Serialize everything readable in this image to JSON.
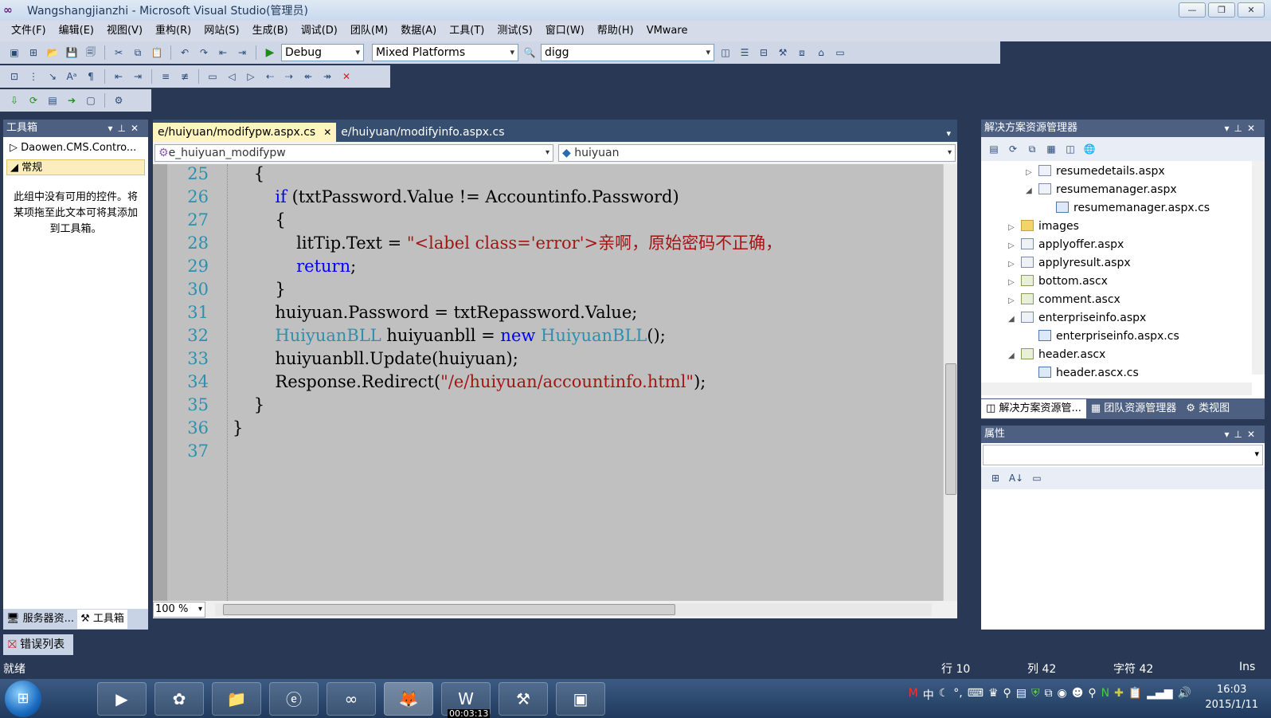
{
  "window": {
    "title": "Wangshangjianzhi - Microsoft Visual Studio(管理员)",
    "minimize": "—",
    "restore": "❐",
    "close": "✕"
  },
  "menu": [
    "文件(F)",
    "编辑(E)",
    "视图(V)",
    "重构(R)",
    "网站(S)",
    "生成(B)",
    "调试(D)",
    "团队(M)",
    "数据(A)",
    "工具(T)",
    "测试(S)",
    "窗口(W)",
    "帮助(H)",
    "VMware"
  ],
  "toolbar": {
    "config": "Debug",
    "platform": "Mixed Platforms",
    "find_value": "digg"
  },
  "toolbox": {
    "title": "工具箱",
    "group_collapsed": "Daowen.CMS.Contro...",
    "group_expanded": "常规",
    "empty_text": "此组中没有可用的控件。将某项拖至此文本可将其添加到工具箱。",
    "tab_server": "服务器资...",
    "tab_toolbox": "工具箱"
  },
  "editor": {
    "tabs": [
      {
        "label": "e/huiyuan/modifypw.aspx.cs",
        "active": true
      },
      {
        "label": "e/huiyuan/modifyinfo.aspx.cs",
        "active": false
      }
    ],
    "class_nav": "e_huiyuan_modifypw",
    "member_nav": "huiyuan",
    "zoom": "100 %",
    "lines": [
      {
        "n": "25",
        "parts": [
          {
            "t": "    {",
            "c": ""
          }
        ]
      },
      {
        "n": "26",
        "parts": [
          {
            "t": "        ",
            "c": ""
          },
          {
            "t": "if",
            "c": "kw"
          },
          {
            "t": " (txtPassword.Value != Accountinfo.Password)",
            "c": ""
          }
        ]
      },
      {
        "n": "27",
        "parts": [
          {
            "t": "        {",
            "c": ""
          }
        ]
      },
      {
        "n": "28",
        "parts": [
          {
            "t": "            litTip.Text = ",
            "c": ""
          },
          {
            "t": "\"<label class='error'>亲啊，原始密码不正确，",
            "c": "st"
          }
        ]
      },
      {
        "n": "29",
        "parts": [
          {
            "t": "            ",
            "c": ""
          },
          {
            "t": "return",
            "c": "kw"
          },
          {
            "t": ";",
            "c": ""
          }
        ]
      },
      {
        "n": "30",
        "parts": [
          {
            "t": "        }",
            "c": ""
          }
        ]
      },
      {
        "n": "31",
        "parts": [
          {
            "t": "        huiyuan.Password = txtRepassword.Value;",
            "c": ""
          }
        ]
      },
      {
        "n": "32",
        "parts": [
          {
            "t": "        ",
            "c": ""
          },
          {
            "t": "HuiyuanBLL",
            "c": "ty"
          },
          {
            "t": " huiyuanbll = ",
            "c": ""
          },
          {
            "t": "new",
            "c": "kw"
          },
          {
            "t": " ",
            "c": ""
          },
          {
            "t": "HuiyuanBLL",
            "c": "ty"
          },
          {
            "t": "();",
            "c": ""
          }
        ]
      },
      {
        "n": "33",
        "parts": [
          {
            "t": "        huiyuanbll.Update(huiyuan);",
            "c": ""
          }
        ]
      },
      {
        "n": "34",
        "parts": [
          {
            "t": "        Response.Redirect(",
            "c": ""
          },
          {
            "t": "\"/e/huiyuan/accountinfo.html\"",
            "c": "st"
          },
          {
            "t": ");",
            "c": ""
          }
        ]
      },
      {
        "n": "35",
        "parts": [
          {
            "t": "    }",
            "c": ""
          }
        ]
      },
      {
        "n": "36",
        "parts": [
          {
            "t": "}",
            "c": ""
          }
        ]
      },
      {
        "n": "37",
        "parts": [
          {
            "t": "",
            "c": ""
          }
        ]
      }
    ]
  },
  "solution": {
    "title": "解决方案资源管理器",
    "items": [
      {
        "label": "resumedetails.aspx",
        "arrow": "▷",
        "icon": "page",
        "indent": 2
      },
      {
        "label": "resumemanager.aspx",
        "arrow": "◢",
        "icon": "page",
        "indent": 2
      },
      {
        "label": "resumemanager.aspx.cs",
        "arrow": "",
        "icon": "cs",
        "indent": 3
      },
      {
        "label": "images",
        "arrow": "▷",
        "icon": "folder",
        "indent": 1
      },
      {
        "label": "applyoffer.aspx",
        "arrow": "▷",
        "icon": "page",
        "indent": 1
      },
      {
        "label": "applyresult.aspx",
        "arrow": "▷",
        "icon": "page",
        "indent": 1
      },
      {
        "label": "bottom.ascx",
        "arrow": "▷",
        "icon": "ascx",
        "indent": 1
      },
      {
        "label": "comment.ascx",
        "arrow": "▷",
        "icon": "ascx",
        "indent": 1
      },
      {
        "label": "enterpriseinfo.aspx",
        "arrow": "◢",
        "icon": "page",
        "indent": 1
      },
      {
        "label": "enterpriseinfo.aspx.cs",
        "arrow": "",
        "icon": "cs",
        "indent": 2
      },
      {
        "label": "header.ascx",
        "arrow": "◢",
        "icon": "ascx",
        "indent": 1
      },
      {
        "label": "header.ascx.cs",
        "arrow": "",
        "icon": "cs",
        "indent": 2
      }
    ],
    "tab_solution": "解决方案资源管...",
    "tab_team": "团队资源管理器",
    "tab_class": "类视图"
  },
  "properties": {
    "title": "属性"
  },
  "errorlist": "错误列表",
  "status": {
    "ready": "就绪",
    "line": "行 10",
    "col": "列 42",
    "char": "字符 42",
    "mode": "Ins"
  },
  "taskbar": {
    "time": "16:03",
    "date": "2015/1/11",
    "recording": "00:03:13"
  }
}
